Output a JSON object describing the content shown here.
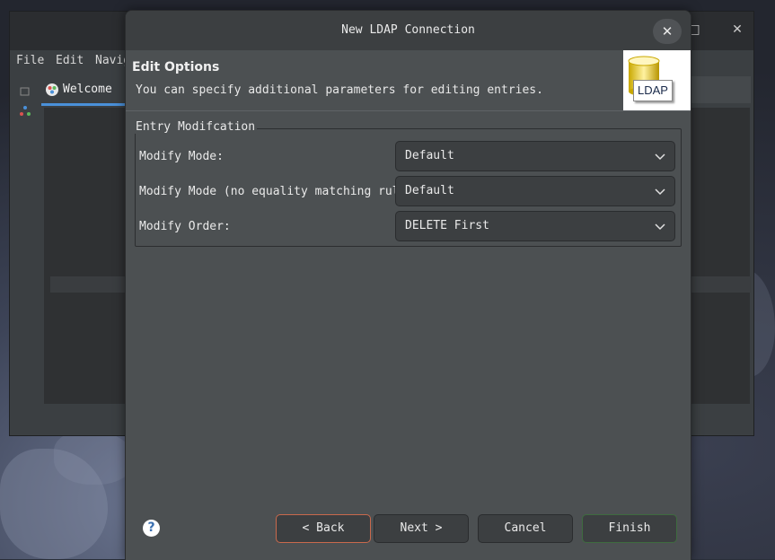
{
  "background_window": {
    "menus": [
      "File",
      "Edit",
      "Navig"
    ],
    "tab_label": "Welcome",
    "window_controls": {
      "maximize": "□",
      "close": "✕"
    }
  },
  "dialog": {
    "title": "New LDAP Connection",
    "close_glyph": "✕",
    "header": {
      "title": "Edit Options",
      "description": "You can specify additional parameters for editing entries.",
      "logo_text": "LDAP"
    },
    "group": {
      "legend": "Entry Modifcation",
      "fields": [
        {
          "label": "Modify Mode:",
          "value": "Default"
        },
        {
          "label": "Modify Mode (no equality matching rule):",
          "value": "Default"
        },
        {
          "label": "Modify Order:",
          "value": "DELETE First"
        }
      ]
    },
    "buttons": {
      "help": "?",
      "back": "< Back",
      "next": "Next >",
      "cancel": "Cancel",
      "finish": "Finish"
    }
  },
  "colors": {
    "dialog_bg": "#4c5052",
    "title_bg": "#3c3f41",
    "focus_border": "#c9694c",
    "default_border": "#3e6b3f",
    "tab_accent": "#4a90d9"
  }
}
